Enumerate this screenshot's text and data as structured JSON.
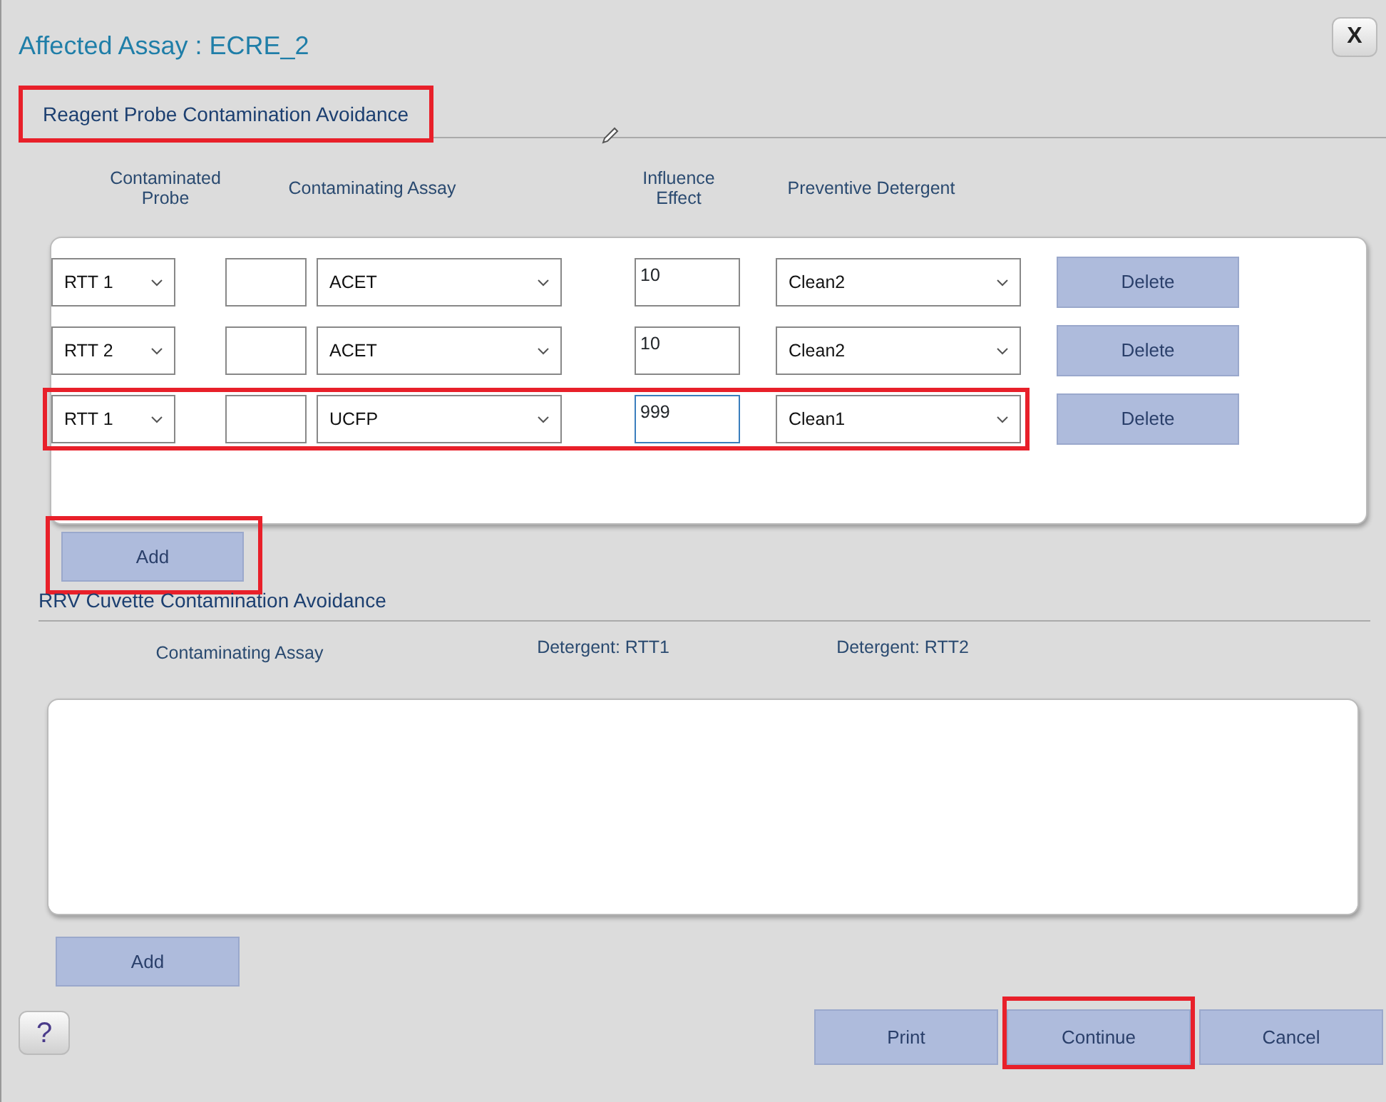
{
  "dialog": {
    "title": "Affected Assay : ECRE_2",
    "close_label": "X"
  },
  "probe_section": {
    "title": "Reagent Probe Contamination Avoidance",
    "highlighted": true,
    "columns": [
      "Contaminated Probe",
      "Contaminating Assay",
      "Influence Effect",
      "Preventive Detergent"
    ],
    "rows": [
      {
        "probe": "RTT 1",
        "assay": "ACET",
        "influence": "10",
        "influence_focused": false,
        "detergent": "Clean2",
        "delete_label": "Delete",
        "highlighted": false
      },
      {
        "probe": "RTT 2",
        "assay": "ACET",
        "influence": "10",
        "influence_focused": false,
        "detergent": "Clean2",
        "delete_label": "Delete",
        "highlighted": false
      },
      {
        "probe": "RTT 1",
        "assay": "UCFP",
        "influence": "999",
        "influence_focused": true,
        "detergent": "Clean1",
        "delete_label": "Delete",
        "highlighted": true
      }
    ],
    "add": {
      "label": "Add",
      "highlighted": true
    }
  },
  "rrv_section": {
    "title": "RRV Cuvette Contamination Avoidance",
    "columns": [
      "Contaminating Assay",
      "Detergent: RTT1",
      "Detergent: RTT2"
    ],
    "add": {
      "label": "Add",
      "highlighted": false
    }
  },
  "footer": {
    "help_label": "?",
    "buttons": [
      {
        "label": "Print",
        "highlighted": false
      },
      {
        "label": "Continue",
        "highlighted": true
      },
      {
        "label": "Cancel",
        "highlighted": false
      }
    ]
  }
}
